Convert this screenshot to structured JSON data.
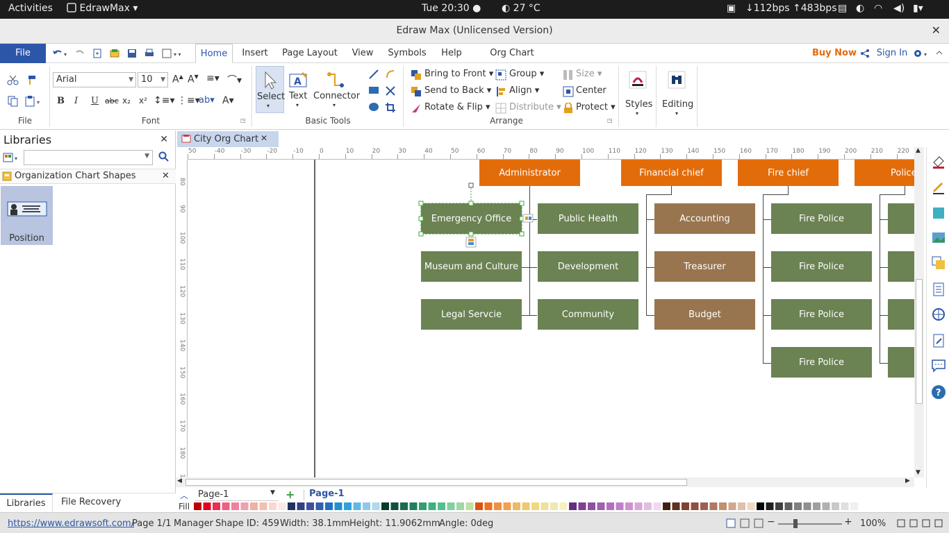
{
  "system_bar": {
    "activities": "Activities",
    "app_menu": "EdrawMax",
    "clock": "Tue 20:30",
    "weather": "27 °C",
    "network": "↓112bps ↑483bps"
  },
  "window": {
    "title": "Edraw Max (Unlicensed Version)"
  },
  "menu": {
    "file": "File",
    "tabs": [
      "Home",
      "Insert",
      "Page Layout",
      "View",
      "Symbols",
      "Help",
      "Org Chart"
    ],
    "buy_now": "Buy Now",
    "sign_in": "Sign In"
  },
  "ribbon": {
    "groups": {
      "file": "File",
      "font": "Font",
      "basic_tools": "Basic Tools",
      "arrange": "Arrange"
    },
    "font_name": "Arial",
    "font_size": "10",
    "select": "Select",
    "text": "Text",
    "connector": "Connector",
    "bring_to_front": "Bring to Front",
    "send_to_back": "Send to Back",
    "rotate_flip": "Rotate & Flip",
    "group": "Group",
    "align": "Align",
    "distribute": "Distribute",
    "size": "Size",
    "center": "Center",
    "protect": "Protect",
    "styles": "Styles",
    "editing": "Editing"
  },
  "libraries": {
    "title": "Libraries",
    "category": "Organization Chart Shapes",
    "shape_label": "Position",
    "bottom_tabs": [
      "Libraries",
      "File Recovery"
    ]
  },
  "document": {
    "tab_title": "City Org Chart"
  },
  "rulers": {
    "h_labels": [
      "50",
      "-40",
      "-30",
      "-20",
      "-10",
      "0",
      "10",
      "20",
      "30",
      "40",
      "50",
      "60",
      "70",
      "80",
      "90",
      "100",
      "110",
      "120",
      "130",
      "140",
      "150",
      "160",
      "170",
      "180",
      "190",
      "200",
      "210",
      "220"
    ],
    "v_labels": [
      "80",
      "90",
      "100",
      "110",
      "120",
      "130",
      "140",
      "150",
      "160",
      "170",
      "180",
      "190"
    ]
  },
  "org_chart": {
    "heads": [
      "Administrator",
      "Financial chief",
      "Fire chief",
      "Police c"
    ],
    "admin_left": [
      "Emergency Office",
      "Museum and Culture",
      "Legal Servcie"
    ],
    "admin_right": [
      "Public Health",
      "Development",
      "Community"
    ],
    "finance": [
      "Accounting",
      "Treasurer",
      "Budget"
    ],
    "fire": [
      "Fire Police",
      "Fire Police",
      "Fire Police",
      "Fire Police"
    ],
    "colors": {
      "head": "#e36c0a",
      "unit": "#6b8252",
      "finance": "#98754f",
      "selection": "#3aa83a"
    }
  },
  "pages": {
    "dropdown": "Page-1",
    "active_tab": "Page-1",
    "fill_label": "Fill"
  },
  "status": {
    "url": "https://www.edrawsoft.com/",
    "page": "Page 1/1",
    "shape_type": "Manager",
    "shape_id": "Shape ID: 459",
    "width": "Width: 38.1mm",
    "height": "Height: 11.9062mm",
    "angle": "Angle: 0deg",
    "zoom": "100%"
  },
  "palette": [
    "#c00000",
    "#e00020",
    "#e83050",
    "#f06080",
    "#f080a0",
    "#f0a0b0",
    "#f0b0a0",
    "#f0c0b0",
    "#f8d8d0",
    "#fce8e8",
    "#203060",
    "#304080",
    "#4050a0",
    "#3060b0",
    "#2070c0",
    "#2090d0",
    "#30a0e0",
    "#60b8e8",
    "#90c8e8",
    "#b0d8f0",
    "#0a3a2a",
    "#105040",
    "#1a6a50",
    "#208060",
    "#30a070",
    "#40b080",
    "#50c090",
    "#80d0a0",
    "#a0d8a0",
    "#c0e0a0",
    "#e05010",
    "#f07020",
    "#f09040",
    "#f0a050",
    "#f0b860",
    "#f0c870",
    "#f0d880",
    "#f0e0a0",
    "#f0e8b0",
    "#f8f0c0",
    "#603080",
    "#804090",
    "#9050a0",
    "#a060b0",
    "#b070c0",
    "#c080c8",
    "#d090d0",
    "#d8a8d8",
    "#e0c0e0",
    "#f0d8f0",
    "#402010",
    "#603020",
    "#804030",
    "#905040",
    "#a06050",
    "#b07860",
    "#c09070",
    "#d0a890",
    "#e0c0a8",
    "#f0d8c0",
    "#000000",
    "#202020",
    "#404040",
    "#606060",
    "#808080",
    "#909090",
    "#a0a0a0",
    "#b0b0b0",
    "#c8c8c8",
    "#e0e0e0",
    "#f0f0f0",
    "#ffffff"
  ]
}
